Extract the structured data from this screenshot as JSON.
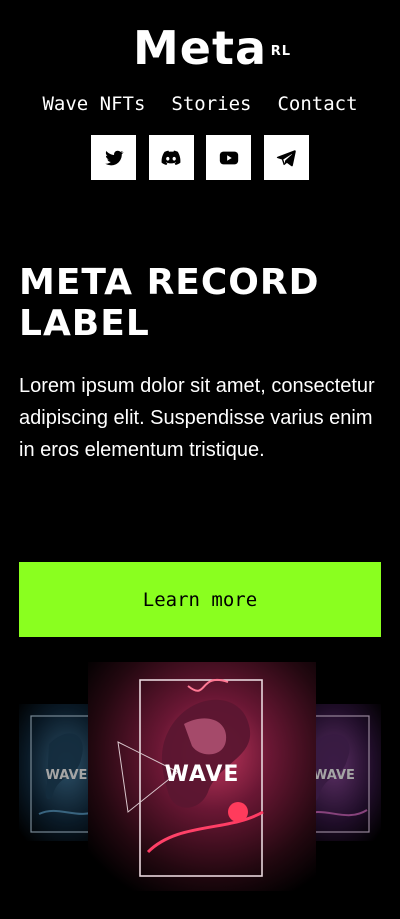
{
  "logo": {
    "name": "Meta",
    "superscript": "RL"
  },
  "nav": {
    "items": [
      "Wave NFTs",
      "Stories",
      "Contact"
    ]
  },
  "socials": [
    "twitter-icon",
    "discord-icon",
    "youtube-icon",
    "telegram-icon"
  ],
  "hero": {
    "title": "META RECORD LABEL",
    "description": "Lorem ipsum dolor sit amet, consectetur adipiscing elit. Suspendisse varius enim in eros elementum tristique.",
    "cta_label": "Learn more"
  },
  "gallery": {
    "cards": [
      "WAVE",
      "WAVE",
      "WAVE"
    ]
  },
  "colors": {
    "background": "#000000",
    "accent": "#8aff1f",
    "text": "#ffffff"
  }
}
